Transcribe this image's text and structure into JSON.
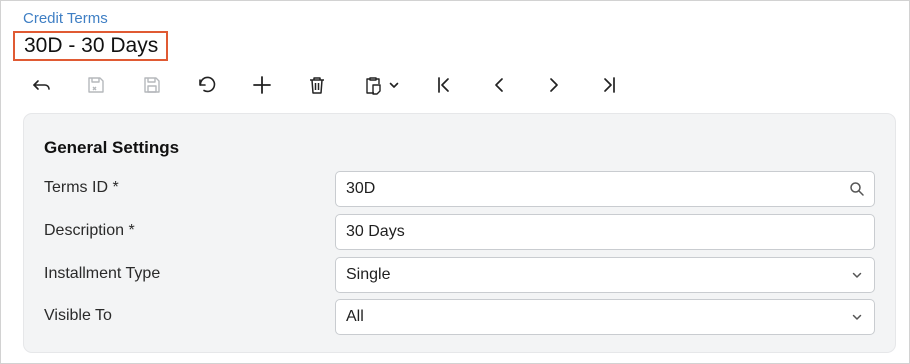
{
  "breadcrumb": "Credit Terms",
  "page_title": "30D - 30 Days",
  "toolbar": {
    "icons": [
      "back-arrow-icon",
      "save-and-close-icon",
      "save-icon",
      "undo-icon",
      "add-icon",
      "delete-icon",
      "copy-paste-icon",
      "first-record-icon",
      "previous-record-icon",
      "next-record-icon",
      "last-record-icon"
    ]
  },
  "section": {
    "title": "General Settings",
    "fields": {
      "terms_id": {
        "label": "Terms ID *",
        "value": "30D"
      },
      "description": {
        "label": "Description *",
        "value": "30 Days"
      },
      "installment_type": {
        "label": "Installment Type",
        "value": "Single"
      },
      "visible_to": {
        "label": "Visible To",
        "value": "All"
      }
    }
  },
  "colors": {
    "accent_link": "#3f7fc4",
    "title_highlight": "#e05a33",
    "panel_bg": "#f3f4f5",
    "disabled_icon": "#b5b8bc"
  }
}
